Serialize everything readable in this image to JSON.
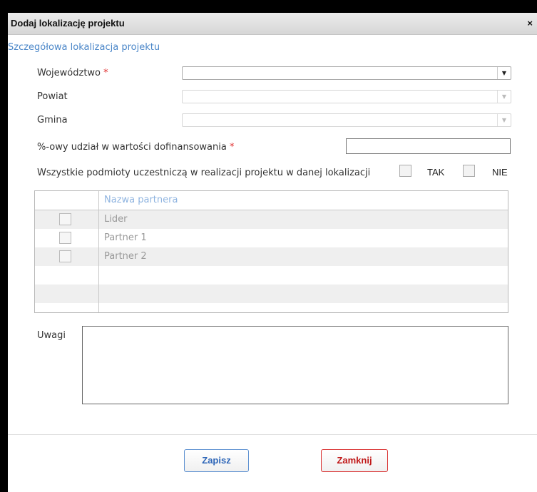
{
  "dialog": {
    "title": "Dodaj lokalizację projektu",
    "close_glyph": "×"
  },
  "section_title": "Szczegółowa lokalizacja projektu",
  "form": {
    "wojewodztwo": {
      "label": "Województwo",
      "required_mark": "*",
      "value": ""
    },
    "powiat": {
      "label": "Powiat",
      "value": ""
    },
    "gmina": {
      "label": "Gmina",
      "value": ""
    },
    "udzial": {
      "label": "%-owy udział w wartości dofinansowania",
      "required_mark": "*",
      "value": ""
    },
    "wszystkie": {
      "label": "Wszystkie podmioty uczestniczą w realizacji projektu w danej lokalizacji",
      "tak": "TAK",
      "nie": "NIE"
    },
    "uwagi": {
      "label": "Uwagi",
      "value": ""
    }
  },
  "partners_table": {
    "header": "Nazwa partnera",
    "rows": [
      "Lider",
      "Partner 1",
      "Partner 2"
    ]
  },
  "buttons": {
    "save": "Zapisz",
    "close": "Zamknij"
  },
  "colors": {
    "section_title": "#4a86c8",
    "required": "#e03030",
    "save_border": "#5b8fd0",
    "close_border": "#d93030"
  },
  "icons": {
    "combo_arrow": "chevron-down-icon",
    "dialog_close": "close-icon"
  }
}
